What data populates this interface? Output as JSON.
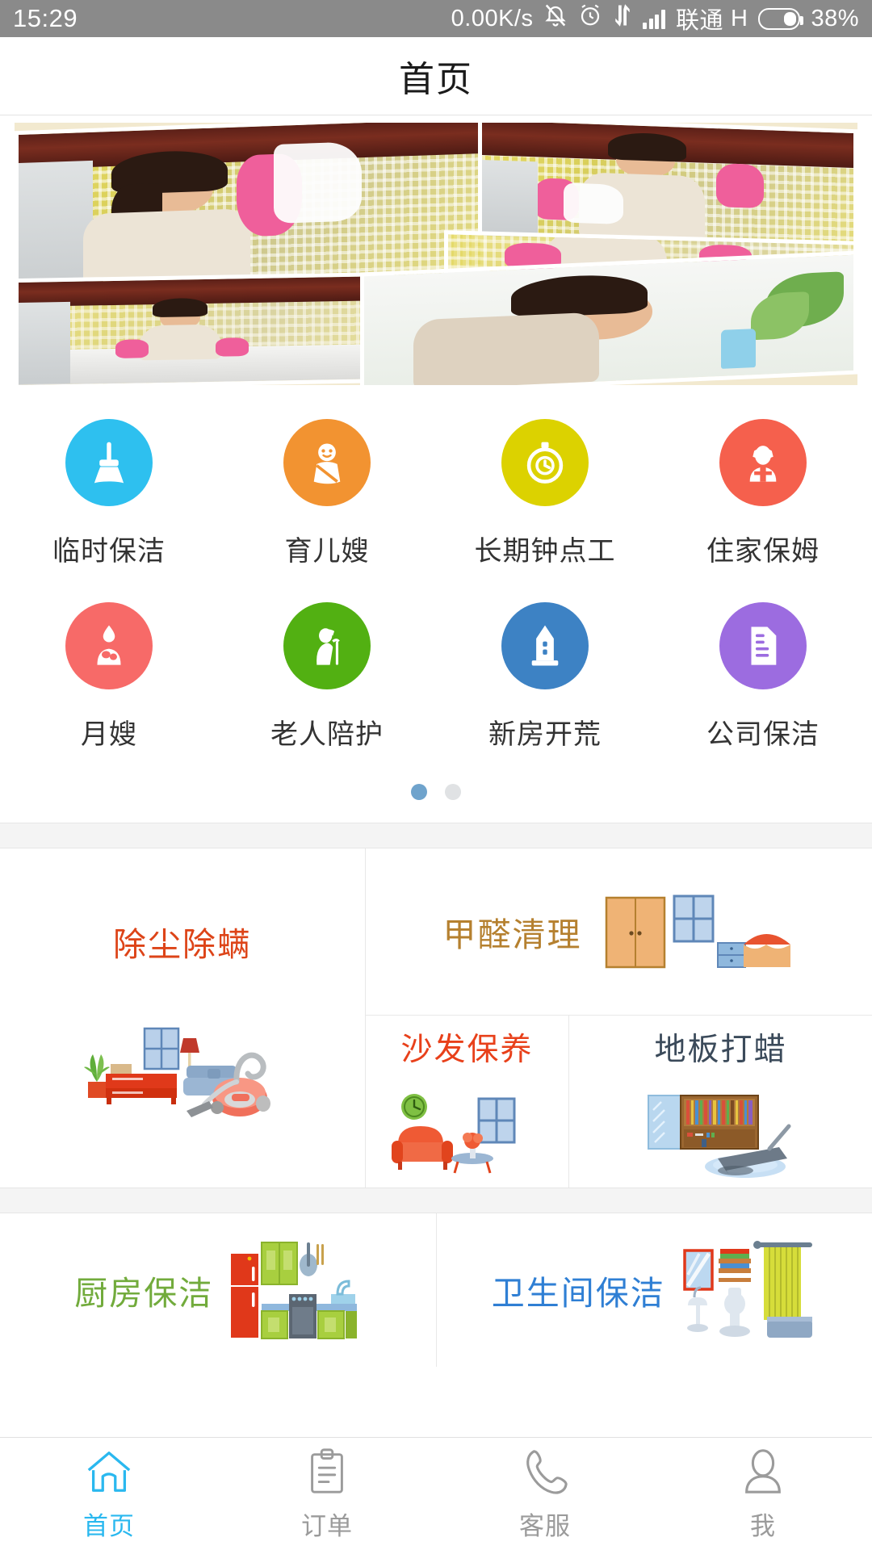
{
  "status_bar": {
    "time": "15:29",
    "net_speed": "0.00K/s",
    "mute_icon": "bell-muted-icon",
    "alarm_icon": "alarm-clock-icon",
    "data_icon": "data-transfer-icon",
    "signal_icon": "signal-bars-icon",
    "carrier": "联通",
    "network_type": "H",
    "battery_icon": "battery-icon",
    "battery_pct": "38%"
  },
  "header": {
    "title": "首页"
  },
  "banner": {
    "name": "promo-banner",
    "alt": "家政保洁服务人员拼图"
  },
  "services": {
    "rows": [
      [
        {
          "label": "临时保洁",
          "color": "#2ec0ef",
          "icon": "broom-icon"
        },
        {
          "label": "育儿嫂",
          "color": "#f29331",
          "icon": "baby-icon"
        },
        {
          "label": "长期钟点工",
          "color": "#dcd200",
          "icon": "stopwatch-icon"
        },
        {
          "label": "住家保姆",
          "color": "#f5604d",
          "icon": "maid-icon"
        }
      ],
      [
        {
          "label": "月嫂",
          "color": "#f76a68",
          "icon": "mother-baby-icon"
        },
        {
          "label": "老人陪护",
          "color": "#52b012",
          "icon": "elderly-care-icon"
        },
        {
          "label": "新房开荒",
          "color": "#3d82c4",
          "icon": "building-icon"
        },
        {
          "label": "公司保洁",
          "color": "#9c6ce0",
          "icon": "document-icon"
        }
      ]
    ],
    "pagination": {
      "active_index": 0,
      "total": 2,
      "active_color": "#6fa3cc",
      "inactive_color": "#e0e2e4"
    }
  },
  "cards": {
    "dust_mite": {
      "title": "除尘除螨",
      "color": "#dd4418",
      "illustration": "vacuum-cleaner-illustration"
    },
    "formaldehyde": {
      "title": "甲醛清理",
      "color": "#b5802f",
      "illustration": "bedroom-wardrobe-illustration"
    },
    "sofa_care": {
      "title": "沙发保养",
      "color": "#e8401a",
      "illustration": "sofa-illustration"
    },
    "floor_wax": {
      "title": "地板打蜡",
      "color": "#3b4a5a",
      "illustration": "floor-polisher-illustration"
    },
    "kitchen": {
      "title": "厨房保洁",
      "color": "#72ab3c",
      "illustration": "kitchen-illustration"
    },
    "bathroom": {
      "title": "卫生间保洁",
      "color": "#2f7fd4",
      "illustration": "bathroom-illustration"
    }
  },
  "tabbar": {
    "active_color": "#2ab8ef",
    "inactive_color": "#9b9b9b",
    "items": [
      {
        "label": "首页",
        "icon": "home-icon",
        "active": true
      },
      {
        "label": "订单",
        "icon": "clipboard-icon",
        "active": false
      },
      {
        "label": "客服",
        "icon": "phone-icon",
        "active": false
      },
      {
        "label": "我",
        "icon": "person-icon",
        "active": false
      }
    ]
  }
}
